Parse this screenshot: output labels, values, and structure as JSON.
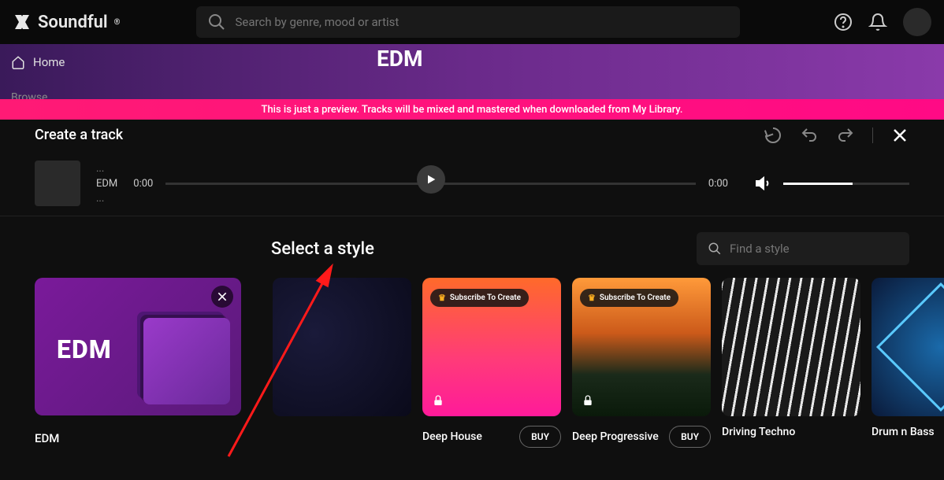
{
  "brand": "Soundful",
  "search_placeholder": "Search by genre, mood or artist",
  "sidebar": {
    "home": "Home",
    "browse": "Browse"
  },
  "bg_title": "EDM",
  "preview_banner": "This is just a preview. Tracks will be mixed and mastered when downloaded from My Library.",
  "panel_title": "Create a track",
  "track": {
    "line1": "...",
    "line2": "EDM",
    "line3": "...",
    "time_start": "0:00",
    "time_end": "0:00"
  },
  "styles_title": "Select a style",
  "find_style_placeholder": "Find a style",
  "category": {
    "logo": "EDM",
    "label": "EDM"
  },
  "subscribe_label": "Subscribe To Create",
  "buy_label": "BUY",
  "styles": [
    {
      "name": ""
    },
    {
      "name": "Deep House",
      "locked": true,
      "buy": true
    },
    {
      "name": "Deep Progressive",
      "locked": true,
      "buy": true
    },
    {
      "name": "Driving Techno"
    },
    {
      "name": "Drum n Bass"
    }
  ]
}
